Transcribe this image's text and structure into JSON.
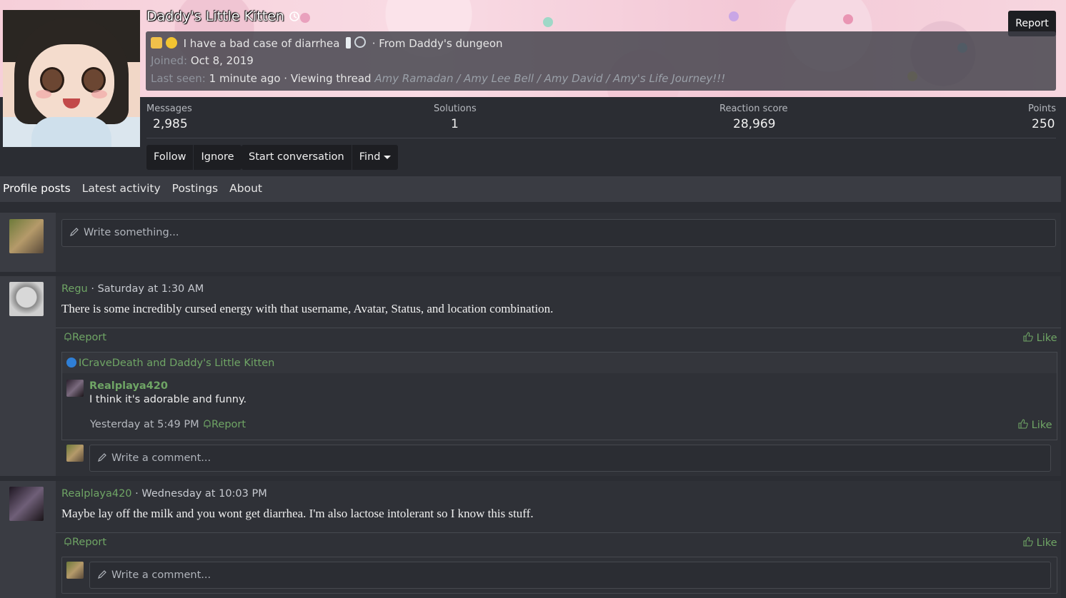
{
  "profile": {
    "username": "Daddy's Little Kitten",
    "username_icon": "history-icon",
    "status": "I have a bad case of diarrhea",
    "location": "· From Daddy's dungeon",
    "joined_label": "Joined:",
    "joined_value": "Oct 8, 2019",
    "last_seen_label": "Last seen:",
    "last_seen_value": "1 minute ago",
    "viewing_label": "· Viewing thread",
    "viewing_thread": "Amy Ramadan / Amy Lee Bell / Amy David / Amy's Life Journey!!!",
    "report_label": "Report"
  },
  "stats": [
    {
      "label": "Messages",
      "value": "2,985"
    },
    {
      "label": "Solutions",
      "value": "1"
    },
    {
      "label": "Reaction score",
      "value": "28,969"
    },
    {
      "label": "Points",
      "value": "250"
    }
  ],
  "actions": {
    "follow": "Follow",
    "ignore": "Ignore",
    "start_conversation": "Start conversation",
    "find": "Find"
  },
  "tabs": [
    "Profile posts",
    "Latest activity",
    "Postings",
    "About"
  ],
  "composer": {
    "placeholder": "Write something..."
  },
  "posts": [
    {
      "author": "Regu",
      "time": "· Saturday at 1:30 AM",
      "text": "There is some incredibly cursed energy with that username, Avatar, Status, and location combination.",
      "report": "Report",
      "like": "Like",
      "reactions": "ICraveDeath and Daddy's Little Kitten",
      "comment": {
        "author": "Realplaya420",
        "text": "I think it's adorable and funny.",
        "time": "Yesterday at 5:49 PM",
        "report": "Report",
        "like": "Like"
      },
      "comment_placeholder": "Write a comment..."
    },
    {
      "author": "Realplaya420",
      "time": "· Wednesday at 10:03 PM",
      "text": "Maybe lay off the milk and you wont get diarrhea. I'm also lactose intolerant so I know this stuff.",
      "report": "Report",
      "like": "Like",
      "comment_placeholder": "Write a comment..."
    }
  ],
  "colors": {
    "accent_green": "#6fa565",
    "background": "#2b2d33",
    "panel": "#3a3c43",
    "button_dark": "#1d1e22"
  }
}
